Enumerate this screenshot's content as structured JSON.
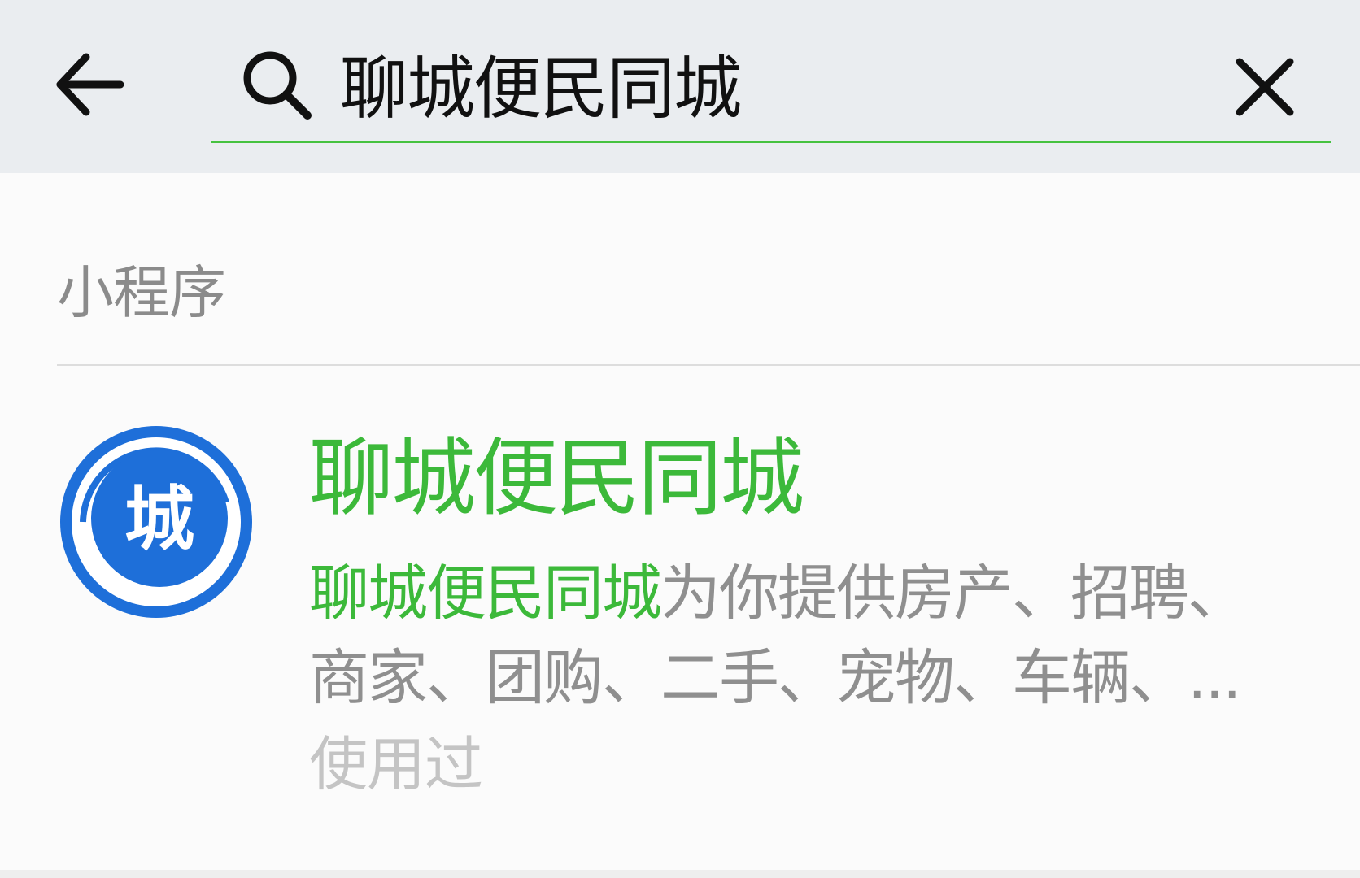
{
  "search": {
    "query": "聊城便民同城",
    "underline_color": "#46c240"
  },
  "section": {
    "title": "小程序"
  },
  "result": {
    "title": "聊城便民同城",
    "desc_highlight": "聊城便民同城",
    "desc_rest_line1": "为你提供房产、招聘、",
    "desc_line2": "商家、团购、二手、宠物、车辆、...",
    "tag": "使用过",
    "avatar_char": "城",
    "avatar_color": "#1e6fd9",
    "title_color": "#3cb93a"
  }
}
